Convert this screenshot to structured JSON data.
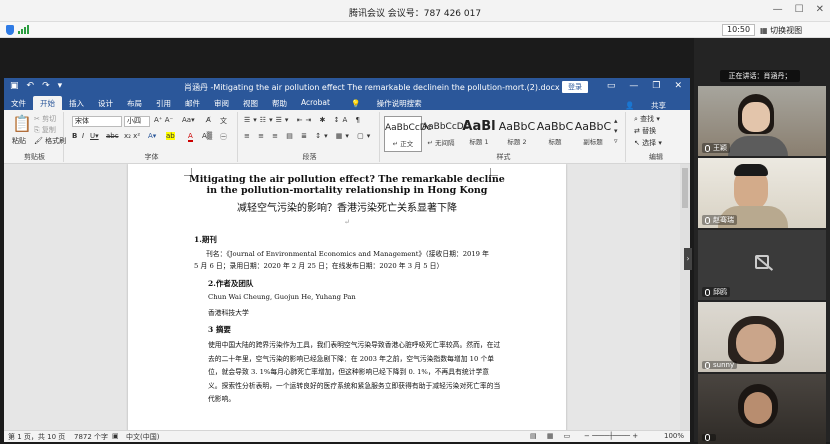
{
  "meeting": {
    "title": "腾讯会议 会议号：787 426 017",
    "time": "10:50",
    "switch_view": "切换视图"
  },
  "speaking": "正在讲话：肖涵丹；",
  "participants": [
    "王颖",
    "赵骞瑞",
    "邱鸥",
    "sunny",
    ""
  ],
  "word": {
    "doc_title": "肖涵丹 -Mitigating the air pollution effect The remarkable declinein the pollution-mort.(2).docx - Word",
    "login": "登录",
    "tabs": [
      "文件",
      "开始",
      "插入",
      "设计",
      "布局",
      "引用",
      "邮件",
      "审阅",
      "视图",
      "帮助",
      "Acrobat",
      "操作说明搜索"
    ],
    "share": "共享",
    "clipboard": {
      "paste": "粘贴",
      "cut": "剪切",
      "copy": "复制",
      "painter": "格式刷",
      "label": "剪贴板"
    },
    "font": {
      "name": "宋体",
      "size": "小四",
      "label": "字体"
    },
    "paragraph_label": "段落",
    "styles": [
      {
        "preview": "AaBbCcDc",
        "label": "↵ 正文"
      },
      {
        "preview": "AaBbCcDc",
        "label": "↵ 无间隔"
      },
      {
        "preview": "AaBl",
        "label": "标题 1"
      },
      {
        "preview": "AaBbC",
        "label": "标题 2"
      },
      {
        "preview": "AaBbC",
        "label": "标题"
      },
      {
        "preview": "AaBbC",
        "label": "副标题"
      }
    ],
    "styles_label": "样式",
    "editing": {
      "find": "查找",
      "replace": "替换",
      "select": "选择",
      "label": "编辑"
    },
    "status": {
      "page": "第 1 页，共 10 页",
      "words": "7872 个字",
      "lang": "中文(中国)",
      "zoom": "100%"
    }
  },
  "document": {
    "title_en": "Mitigating the air pollution effect? The remarkable decline in the pollution-mortality relationship in Hong Kong",
    "title_zh": "减轻空气污染的影响？香港污染死亡关系显著下降",
    "h1": "1.期刊",
    "journal": "刊名：《Journal of Environmental Economics and Management》（接收日期：2019 年 5 月 6 日；录用日期：2020 年 2 月 25 日；在线发布日期：2020 年 3 月 5 日）",
    "h2": "2.作者及团队",
    "authors": "Chun Wai Cheung, Guojun He, Yuhang Pan",
    "affil": "香港科技大学",
    "h3": "3 摘要",
    "abstract": "使用中国大陆的跨界污染作为工具，我们表明空气污染导致香港心脏呼吸死亡率较高。然而，在过去的二十年里，空气污染的影响已经急剧下降：在 2003 年之前，空气污染指数每增加 10 个单位，就会导致 3. 1%每月心肺死亡率增加，但这种影响已经下降到 0. 1%，不再具有统计学意义。探索性分析表明，一个运转良好的医疗系统和紧急服务立即获得有助于减轻污染对死亡率的当代影响。"
  }
}
